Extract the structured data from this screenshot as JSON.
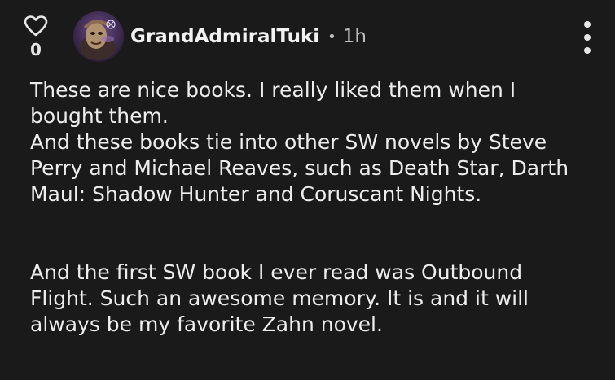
{
  "comment": {
    "like_count": "0",
    "username": "GrandAdmiralTuki",
    "separator": "•",
    "time_ago": "1h",
    "paragraphs": [
      "These are nice books. I really liked them when I bought them.",
      "And these books tie into other SW novels by Steve Perry and Michael Reaves, such as Death Star, Darth Maul: Shadow Hunter and Coruscant Nights.",
      "And the first SW book I ever read was Outbound Flight. Such an awesome memory. It is and it will always be my favorite Zahn novel."
    ]
  },
  "icons": {
    "like": "heart-outline-icon",
    "menu": "kebab-menu-icon",
    "avatar": "user-avatar"
  },
  "colors": {
    "background": "#1a1a1a",
    "text": "#ededed",
    "muted": "#bdbdbd"
  }
}
